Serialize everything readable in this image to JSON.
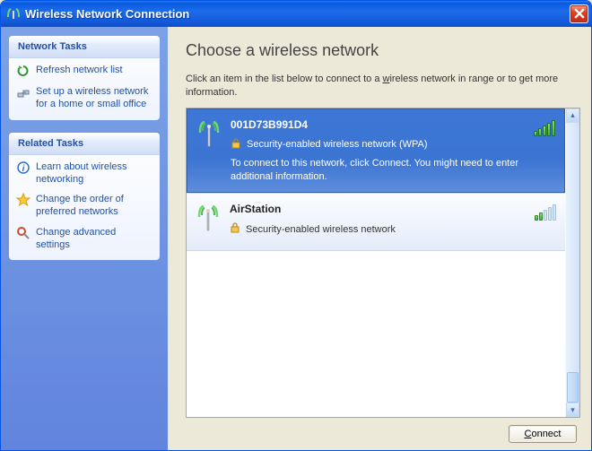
{
  "window": {
    "title": "Wireless Network Connection"
  },
  "sidebar": {
    "panels": [
      {
        "title": "Network Tasks",
        "items": [
          {
            "icon": "refresh-icon",
            "label": "Refresh network list"
          },
          {
            "icon": "setup-icon",
            "label": "Set up a wireless network for a home or small office"
          }
        ]
      },
      {
        "title": "Related Tasks",
        "items": [
          {
            "icon": "info-icon",
            "label": "Learn about wireless networking"
          },
          {
            "icon": "star-icon",
            "label": "Change the order of preferred networks"
          },
          {
            "icon": "settings-icon",
            "label": "Change advanced settings"
          }
        ]
      }
    ]
  },
  "main": {
    "heading": "Choose a wireless network",
    "subtext_pre": "Click an item in the list below to connect to a ",
    "subtext_u": "w",
    "subtext_post1": "ireless network in range or to get more information.",
    "connect_label": "Connect"
  },
  "networks": [
    {
      "name": "001D73B991D4",
      "security_text": "Security-enabled wireless network (WPA)",
      "description": "To connect to this network, click Connect. You might need to enter additional information.",
      "selected": true,
      "signal_bars": 5
    },
    {
      "name": "AirStation",
      "security_text": "Security-enabled wireless network",
      "description": "",
      "selected": false,
      "signal_bars": 2
    }
  ]
}
